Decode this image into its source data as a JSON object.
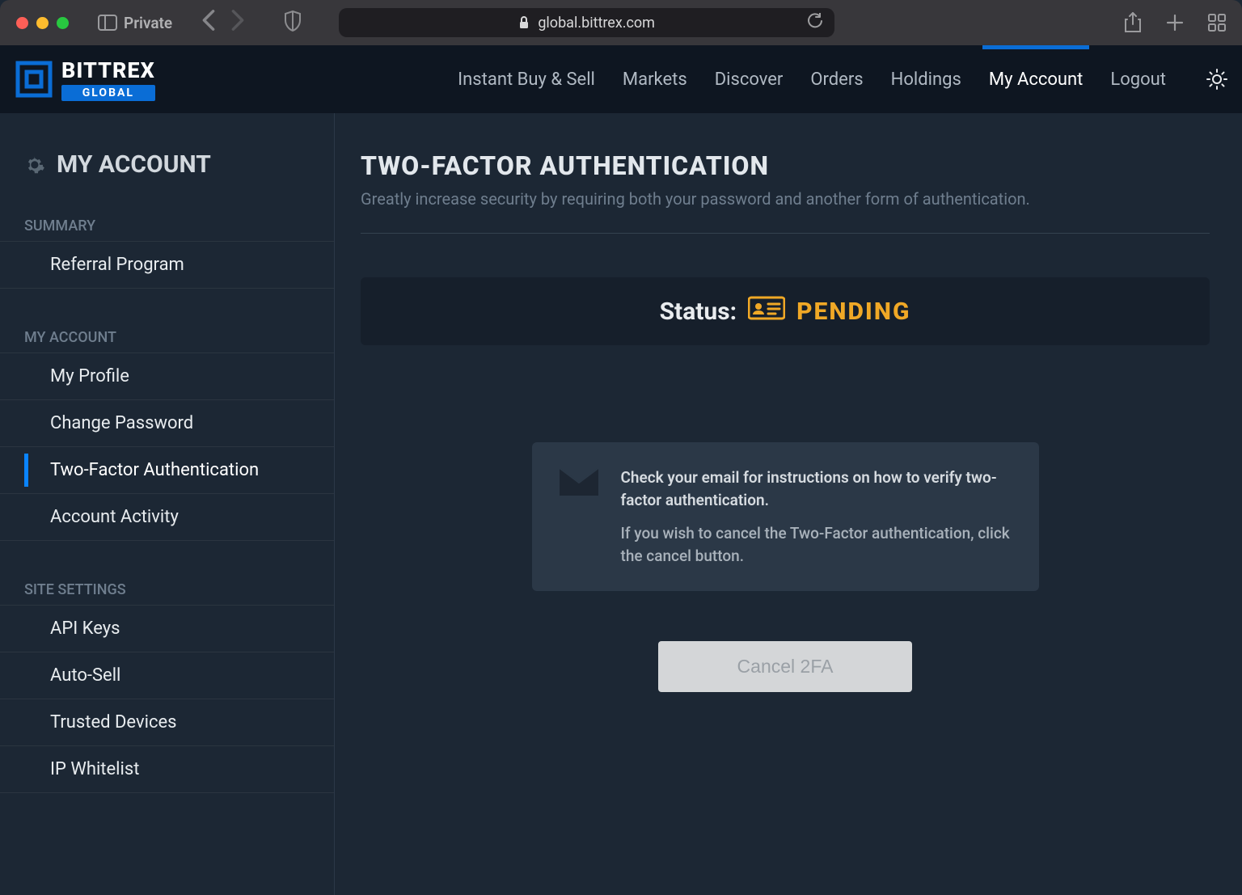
{
  "browser": {
    "private_label": "Private",
    "url": "global.bittrex.com"
  },
  "topnav": {
    "brand_primary": "BITTREX",
    "brand_secondary": "GLOBAL",
    "links": [
      "Instant Buy & Sell",
      "Markets",
      "Discover",
      "Orders",
      "Holdings",
      "My Account",
      "Logout"
    ],
    "active_index": 5
  },
  "sidebar": {
    "title": "MY ACCOUNT",
    "sections": [
      {
        "label": "SUMMARY",
        "items": [
          "Referral Program"
        ]
      },
      {
        "label": "MY ACCOUNT",
        "items": [
          "My Profile",
          "Change Password",
          "Two-Factor Authentication",
          "Account Activity"
        ],
        "active_index": 2
      },
      {
        "label": "SITE SETTINGS",
        "items": [
          "API Keys",
          "Auto-Sell",
          "Trusted Devices",
          "IP Whitelist"
        ]
      }
    ]
  },
  "page": {
    "title": "TWO-FACTOR AUTHENTICATION",
    "subtitle": "Greatly increase security by requiring both your password and another form of authentication.",
    "status_label": "Status:",
    "status_value": "PENDING",
    "info_line1": "Check your email for instructions on how to verify two-factor authentication.",
    "info_line2": "If you wish to cancel the Two-Factor authentication, click the cancel button.",
    "cancel_label": "Cancel 2FA"
  }
}
